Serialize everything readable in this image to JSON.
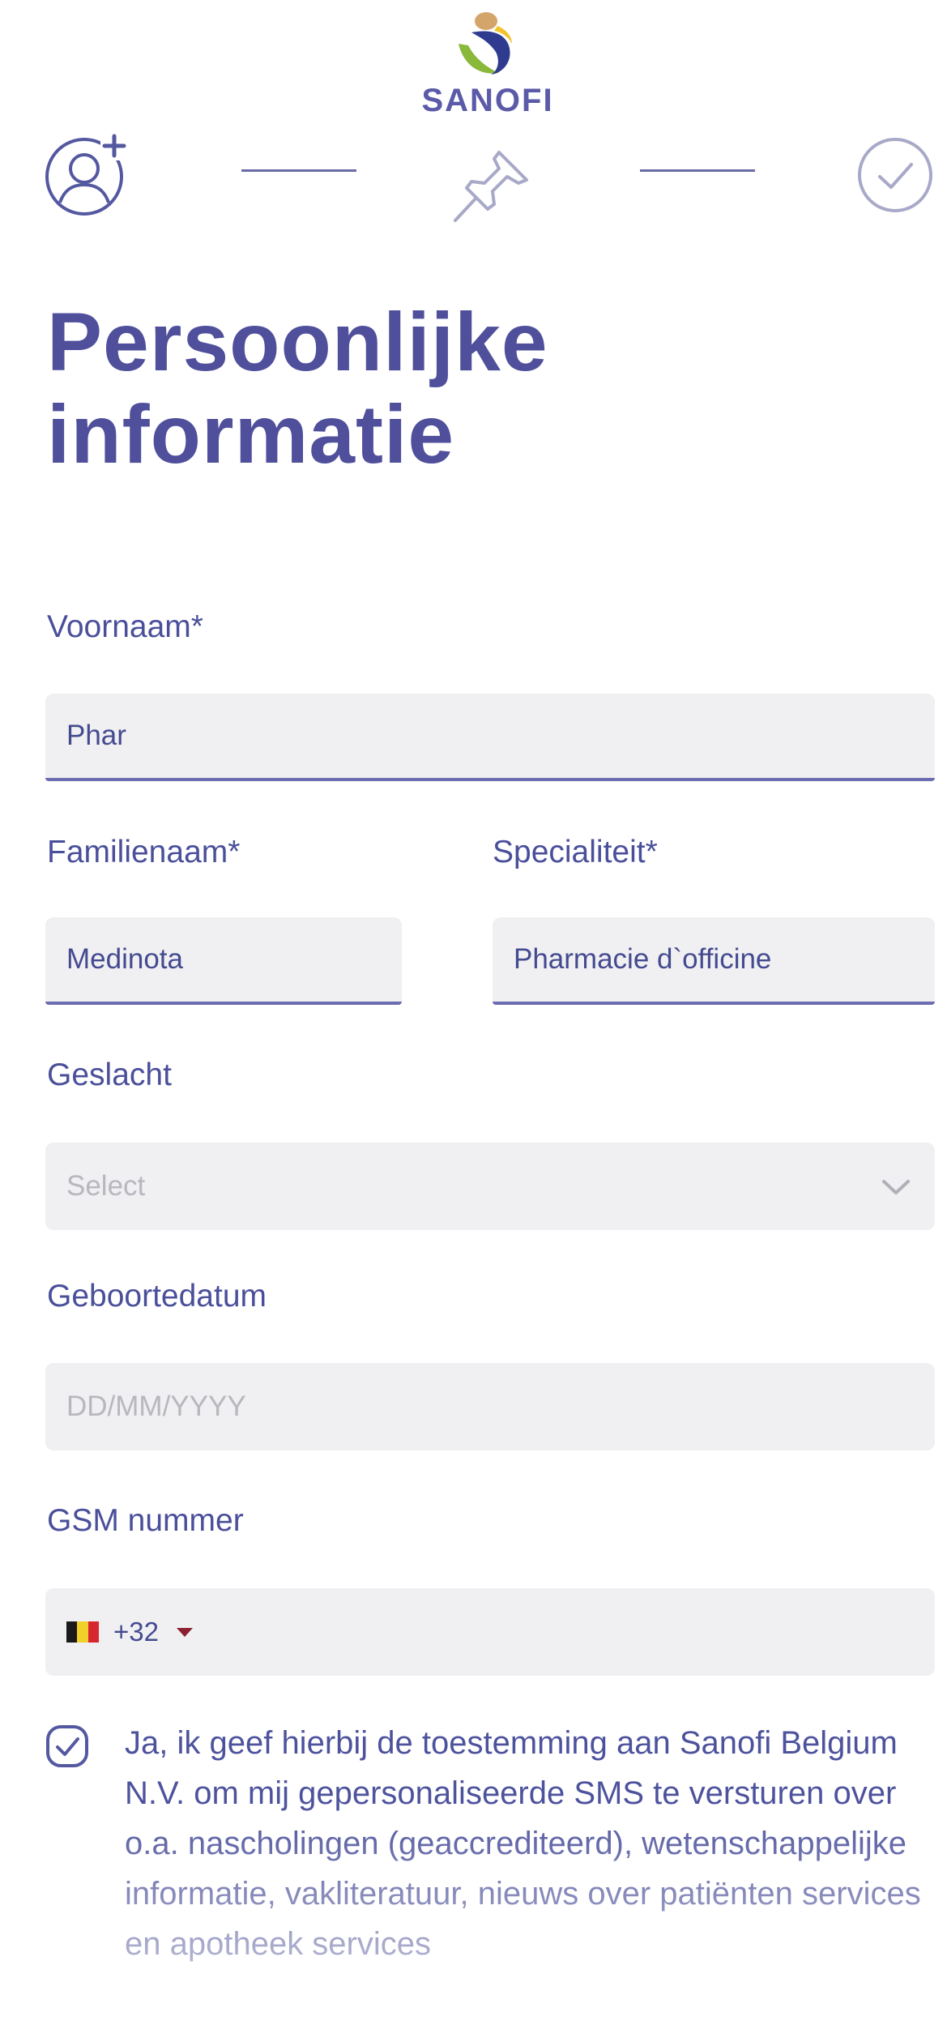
{
  "brand": {
    "name": "SANOFI"
  },
  "stepper": {
    "steps": [
      {
        "name": "personal-info",
        "icon": "user-add-icon",
        "state": "active"
      },
      {
        "name": "specialty",
        "icon": "pin-icon",
        "state": "pending"
      },
      {
        "name": "done",
        "icon": "check-circle-icon",
        "state": "pending"
      }
    ]
  },
  "page": {
    "title": "Persoonlijke informatie"
  },
  "form": {
    "first_name": {
      "label": "Voornaam*",
      "value": "Phar"
    },
    "last_name": {
      "label": "Familienaam*",
      "value": "Medinota"
    },
    "specialty": {
      "label": "Specialiteit*",
      "value": "Pharmacie d`officine"
    },
    "gender": {
      "label": "Geslacht",
      "placeholder": "Select"
    },
    "birthdate": {
      "label": "Geboortedatum",
      "placeholder": "DD/MM/YYYY"
    },
    "phone": {
      "label": "GSM nummer",
      "dial_code": "+32",
      "country_flag": "belgium-flag-icon"
    },
    "consent": {
      "checked": true,
      "text": "Ja, ik geef hierbij de toestemming aan Sanofi Belgium N.V. om mij gepersonaliseerde SMS te versturen over o.a. nascholingen (geaccrediteerd), wetenschappelijke informatie, vakliteratuur, nieuws over patiënten services en apotheek services"
    }
  },
  "colors": {
    "primary": "#4f4f9c",
    "field_bg": "#f0f0f3",
    "underline": "#6c6cb0",
    "placeholder": "#b7b7bd"
  }
}
